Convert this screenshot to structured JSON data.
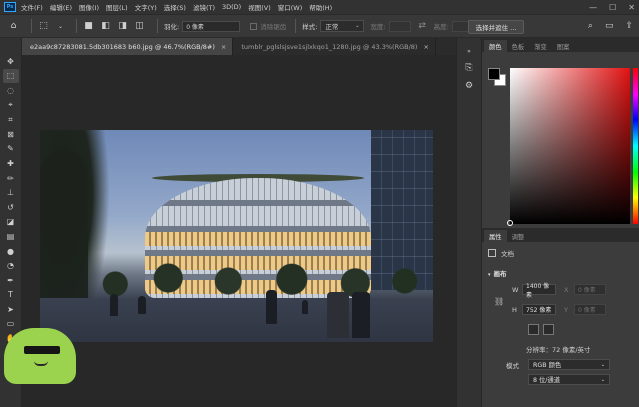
{
  "app": {
    "logo": "Ps",
    "menu": [
      "文件(F)",
      "编辑(E)",
      "图像(I)",
      "图层(L)",
      "文字(Y)",
      "选择(S)",
      "滤镜(T)",
      "3D(D)",
      "视图(V)",
      "窗口(W)",
      "帮助(H)"
    ],
    "window_controls": [
      "—",
      "☐",
      "✕"
    ]
  },
  "options_bar": {
    "feather_label": "羽化:",
    "feather_value": "0 像素",
    "antialias_label": "消除锯齿",
    "style_label": "样式:",
    "style_value": "正常",
    "width_label": "宽度:",
    "height_label": "高度:",
    "select_subject_label": "选择并遮住 ..."
  },
  "tabs": [
    {
      "label": "e2aa9c87283081.5db301683 b60.jpg @ 46.7%(RGB/8#)",
      "active": true
    },
    {
      "label": "tumblr_pglslsjsve1sjlxkqo1_1280.jpg @ 43.3%(RGB/8)",
      "active": false
    }
  ],
  "tab_close": "×",
  "color_panel": {
    "tabs": [
      "颜色",
      "色板",
      "渐变",
      "图案"
    ],
    "active_tab": 0,
    "fg_color": "#000000",
    "bg_color": "#ffffff"
  },
  "properties_panel": {
    "tabs": [
      "属性",
      "调整"
    ],
    "active_tab": 0,
    "doc_label": "文档",
    "section_title": "画布",
    "width_label": "W",
    "width_value": "1400 像素",
    "height_label": "H",
    "height_value": "752 像素",
    "x_label": "X",
    "x_value": "0 像素",
    "y_label": "Y",
    "y_value": "0 像素",
    "resolution": "分辨率：72 像素/英寸",
    "mode_label": "模式",
    "mode_value": "RGB 颜色",
    "bits_value": "8 位/通道"
  }
}
